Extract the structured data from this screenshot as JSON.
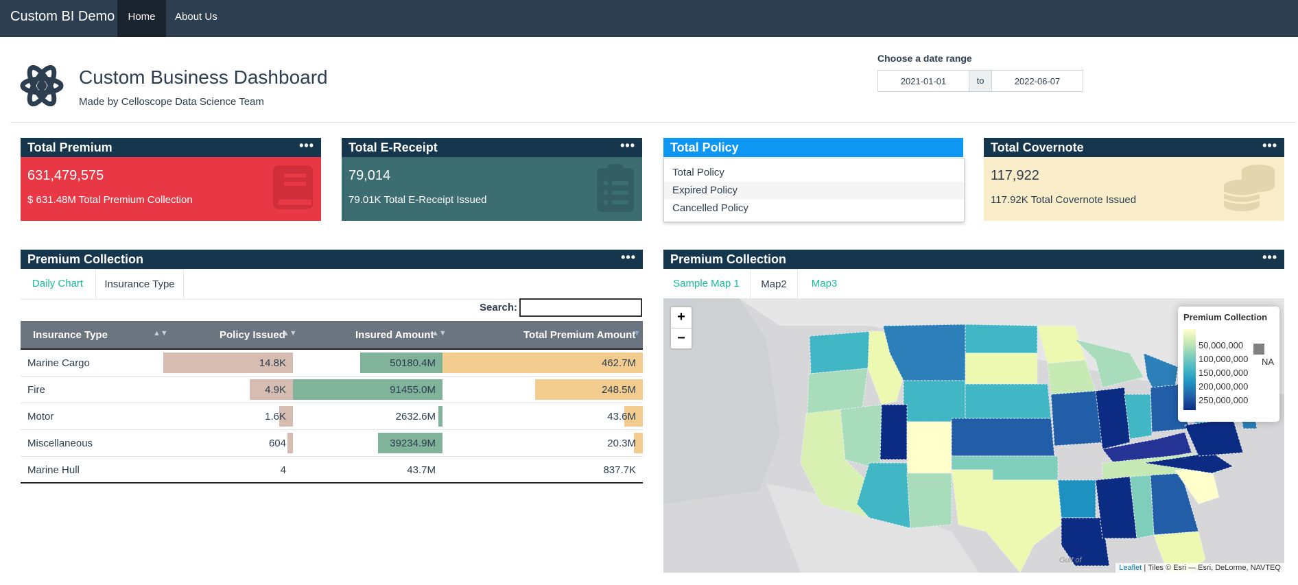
{
  "navbar": {
    "brand": "Custom BI Demo",
    "home": "Home",
    "about": "About Us"
  },
  "header": {
    "title": "Custom Business Dashboard",
    "subtitle": "Made by Celloscope Data Science Team",
    "logo_icon": "atom-icon"
  },
  "date_range": {
    "label": "Choose a date range",
    "start": "2021-01-01",
    "separator": "to",
    "end": "2022-06-07"
  },
  "cards": {
    "premium": {
      "title": "Total Premium",
      "menu": "•••",
      "value": "631,479,575",
      "subtitle": "$ 631.48M Total Premium Collection",
      "color": "#e83845",
      "icon": "book-icon"
    },
    "ereceipt": {
      "title": "Total E-Receipt",
      "menu": "•••",
      "value": "79,014",
      "subtitle": "79.01K Total E-Receipt Issued",
      "color": "#3c6e71",
      "icon": "clipboard-list-icon"
    },
    "policy": {
      "title": "Total Policy",
      "menu_options": [
        "Total Policy",
        "Expired Policy",
        "Cancelled Policy"
      ]
    },
    "covernote": {
      "title": "Total Covernote",
      "menu": "•••",
      "value": "117,922",
      "subtitle": "117.92K Total Covernote Issued",
      "color": "#f8ecc9",
      "icon": "coins-icon"
    }
  },
  "left_panel": {
    "title": "Premium Collection",
    "menu": "•••",
    "tabs": [
      "Daily Chart",
      "Insurance Type"
    ],
    "active_tab": "Insurance Type",
    "search_label": "Search:",
    "search_value": "",
    "columns": [
      "Insurance Type",
      "Policy Issued",
      "Insured Amount",
      "Total Premium Amount"
    ],
    "rows": [
      {
        "type": "Marine Cargo",
        "policy_issued": "14.8K",
        "insured_amount": "50180.4M",
        "total_premium": "462.7M",
        "policy_frac": 1.0,
        "insured_frac": 0.549,
        "premium_frac": 1.0
      },
      {
        "type": "Fire",
        "policy_issued": "4.9K",
        "insured_amount": "91455.0M",
        "total_premium": "248.5M",
        "policy_frac": 0.331,
        "insured_frac": 1.0,
        "premium_frac": 0.537
      },
      {
        "type": "Motor",
        "policy_issued": "1.6K",
        "insured_amount": "2632.6M",
        "total_premium": "43.6M",
        "policy_frac": 0.108,
        "insured_frac": 0.029,
        "premium_frac": 0.094
      },
      {
        "type": "Miscellaneous",
        "policy_issued": "604",
        "insured_amount": "39234.9M",
        "total_premium": "20.3M",
        "policy_frac": 0.041,
        "insured_frac": 0.429,
        "premium_frac": 0.044
      },
      {
        "type": "Marine Hull",
        "policy_issued": "4",
        "insured_amount": "43.7M",
        "total_premium": "837.7K",
        "policy_frac": 0.0,
        "insured_frac": 0.0,
        "premium_frac": 0.0
      }
    ],
    "bar_colors": {
      "policy": "#d7bdb1",
      "insured": "#81b29a",
      "premium": "#f2cc8f"
    }
  },
  "right_panel": {
    "title": "Premium Collection",
    "menu": "•••",
    "tabs": [
      "Sample Map 1",
      "Map2",
      "Map3"
    ],
    "active_tab": "Map2",
    "zoom_in": "+",
    "zoom_out": "−",
    "legend": {
      "title": "Premium Collection",
      "ticks": [
        "50,000,000",
        "100,000,000",
        "150,000,000",
        "200,000,000",
        "250,000,000"
      ],
      "na": "NA"
    },
    "attribution": {
      "leaflet": "Leaflet",
      "tiles": "| Tiles © Esri — Esri, DeLorme, NAVTEQ"
    },
    "map_label": "Gulf of"
  }
}
